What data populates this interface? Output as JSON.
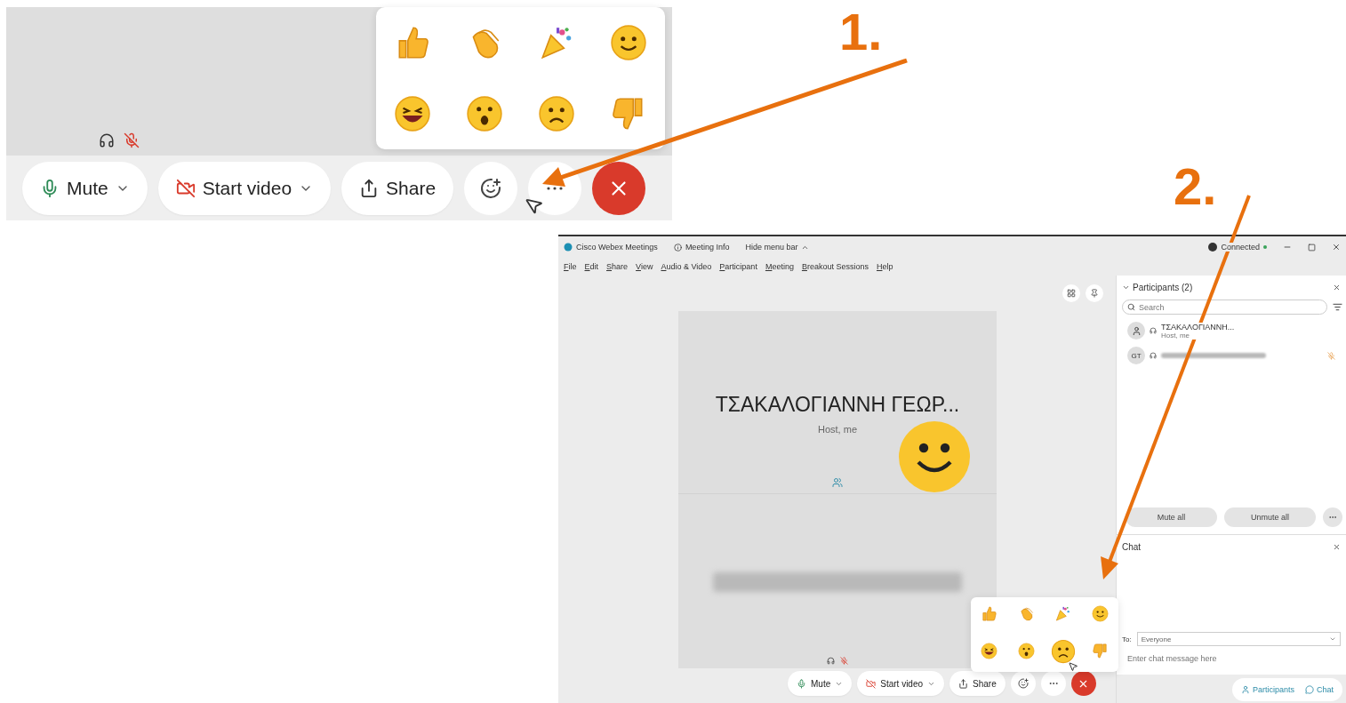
{
  "callouts": [
    {
      "label": "1."
    },
    {
      "label": "2."
    }
  ],
  "closeup": {
    "reactions": [
      {
        "kind": "thumbs_up"
      },
      {
        "kind": "clap"
      },
      {
        "kind": "party"
      },
      {
        "kind": "smile"
      },
      {
        "kind": "laugh"
      },
      {
        "kind": "surprised"
      },
      {
        "kind": "sad"
      },
      {
        "kind": "thumbs_down"
      }
    ],
    "toolbar": [
      {
        "kind": "mute",
        "label": "Mute"
      },
      {
        "kind": "video",
        "label": "Start video"
      },
      {
        "kind": "share",
        "label": "Share"
      }
    ]
  },
  "window": {
    "title": "Cisco Webex Meetings",
    "meeting_info": "Meeting Info",
    "hide_menu": "Hide menu bar",
    "status": "Connected",
    "menu": [
      "File",
      "Edit",
      "Share",
      "View",
      "Audio & Video",
      "Participant",
      "Meeting",
      "Breakout Sessions",
      "Help"
    ],
    "tile": {
      "name": "ΤΣΑΚΑΛΟΓΙΑΝΝΗ ΓΕΩΡ...",
      "role": "Host, me"
    },
    "participants": {
      "title": "Participants (2)",
      "search_placeholder": "Search",
      "items": [
        {
          "kind": "avatar",
          "name": "ΤΣΑΚΑΛΟΓΙΑΝΝΗ...",
          "role": "Host, me"
        },
        {
          "kind": "initials",
          "initials": "GT"
        }
      ],
      "buttons": [
        "Mute all",
        "Unmute all"
      ]
    },
    "chat": {
      "title": "Chat",
      "to_label": "To:",
      "recipient": "Everyone",
      "placeholder": "Enter chat message here"
    },
    "toolbar": [
      {
        "kind": "mute",
        "label": "Mute"
      },
      {
        "kind": "video",
        "label": "Start video"
      },
      {
        "kind": "share",
        "label": "Share"
      }
    ],
    "reactions": [
      {
        "kind": "thumbs_up",
        "hovered": false
      },
      {
        "kind": "clap",
        "hovered": false
      },
      {
        "kind": "party",
        "hovered": false
      },
      {
        "kind": "smile",
        "hovered": false
      },
      {
        "kind": "laugh",
        "hovered": false
      },
      {
        "kind": "surprised",
        "hovered": false
      },
      {
        "kind": "sad",
        "hovered": true
      },
      {
        "kind": "thumbs_down",
        "hovered": false
      }
    ],
    "tabs": [
      {
        "kind": "participants",
        "label": "Participants"
      },
      {
        "kind": "chat",
        "label": "Chat"
      }
    ]
  }
}
